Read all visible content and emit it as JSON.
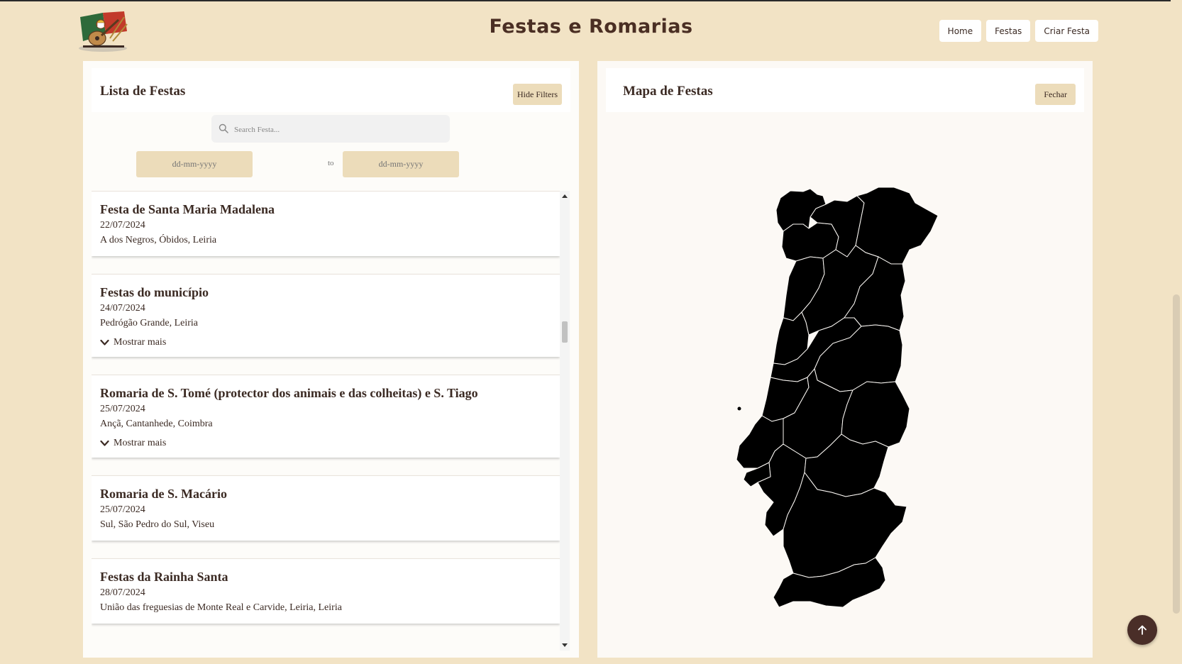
{
  "header": {
    "title": "Festas e Romarias",
    "nav": [
      "Home",
      "Festas",
      "Criar Festa"
    ]
  },
  "list_panel": {
    "title": "Lista de Festas",
    "toggle_filters_label": "Hide Filters",
    "search_placeholder": "Search Festa...",
    "date_from_placeholder": "dd-mm-yyyy",
    "date_to_placeholder": "dd-mm-yyyy",
    "date_separator": "to",
    "show_more_label": "Mostrar mais",
    "festas": [
      {
        "name": "Festa de Santa Maria Madalena",
        "date": "22/07/2024",
        "location": "A dos Negros, Óbidos, Leiria",
        "has_more": false
      },
      {
        "name": "Festas do município",
        "date": "24/07/2024",
        "location": "Pedrógão Grande, Leiria",
        "has_more": true
      },
      {
        "name": "Romaria de S. Tomé (protector dos animais e das colheitas) e S. Tiago",
        "date": "25/07/2024",
        "location": "Ançã, Cantanhede, Coimbra",
        "has_more": true
      },
      {
        "name": "Romaria de S. Macário",
        "date": "25/07/2024",
        "location": "Sul, São Pedro do Sul, Viseu",
        "has_more": false
      },
      {
        "name": "Festas da Rainha Santa",
        "date": "28/07/2024",
        "location": "União das freguesias de Monte Real e Carvide, Leiria, Leiria",
        "has_more": false
      }
    ]
  },
  "map_panel": {
    "title": "Mapa de Festas",
    "close_label": "Fechar"
  },
  "icons": {
    "search": "search-icon",
    "chevron": "chevron-down-icon",
    "back_to_top": "arrow-up-icon"
  },
  "colors": {
    "page_bg": "#f2e3c5",
    "button_bg": "#ecdcba",
    "text": "#3b2a23",
    "fab": "#4a2e28"
  }
}
